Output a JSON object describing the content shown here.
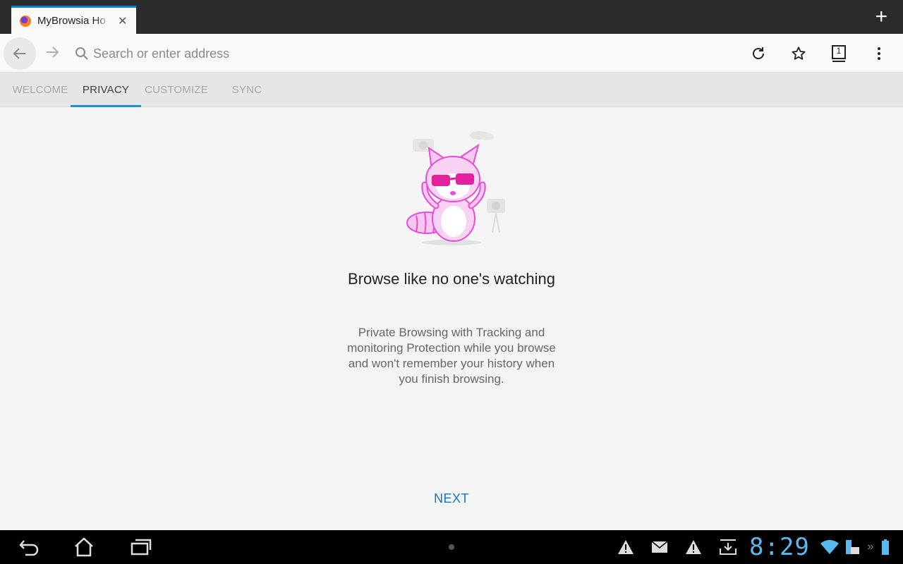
{
  "tab": {
    "title": "MyBrowsia Ho",
    "close": "✕"
  },
  "new_tab": "+",
  "toolbar": {
    "search_placeholder": "Search or enter address",
    "tabs_count": "1"
  },
  "onboarding_tabs": [
    {
      "label": "WELCOME"
    },
    {
      "label": "PRIVACY"
    },
    {
      "label": "CUSTOMIZE"
    },
    {
      "label": "SYNC"
    }
  ],
  "content": {
    "headline": "Browse like no one's watching",
    "body": "Private Browsing with Tracking and monitoring Protection while you browse and won't remember your history when you finish browsing.",
    "next": "NEXT"
  },
  "system": {
    "clock": "8:29"
  },
  "colors": {
    "accent": "#1e90d6",
    "next": "#1078c8",
    "clock": "#59b8ee",
    "mascot": "#e84bd6"
  }
}
